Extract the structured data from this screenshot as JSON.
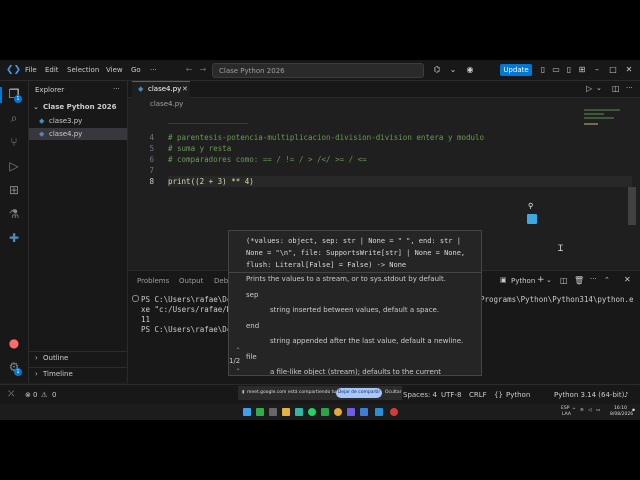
{
  "titlebar": {
    "menu": [
      "File",
      "Edit",
      "Selection",
      "View",
      "Go"
    ],
    "more": "···",
    "search_text": "Clase Python 2026",
    "update_label": "Update"
  },
  "sidebar": {
    "header": "Explorer",
    "folder": "Clase Python 2026",
    "files": [
      "clase3.py",
      "clase4.py"
    ],
    "outline": "Outline",
    "timeline": "Timeline"
  },
  "editor": {
    "tab_label": "clase4.py",
    "breadcrumb": "clase4.py",
    "lines": [
      {
        "num": "4",
        "text": "# parentesis-potencia-multiplicacion-division-division entera y modulo",
        "type": "comment"
      },
      {
        "num": "5",
        "text": "# suma y resta",
        "type": "comment"
      },
      {
        "num": "6",
        "text": "# comparadores como: == / != / > /</ >= / <=",
        "type": "comment"
      },
      {
        "num": "7",
        "text": "",
        "type": "blank"
      },
      {
        "num": "8",
        "text": "print((2 + 3) ** 4)",
        "type": "code"
      }
    ]
  },
  "hover": {
    "signature": "(*values: object, sep: str | None = \" \", end: str | None = \"\\n\", file: SupportsWrite[str] | None = None, flush: Literal[False] = False) -> None",
    "description": "Prints the values to a stream, or to sys.stdout by default.",
    "params": [
      {
        "name": "sep",
        "desc": "string inserted between values, default a space."
      },
      {
        "name": "end",
        "desc": "string appended after the last value, default a newline."
      },
      {
        "name": "file",
        "desc": "a file-like object (stream); defaults to the current"
      }
    ],
    "counter": "1/2"
  },
  "panel": {
    "tabs": [
      "Problems",
      "Output",
      "Deb"
    ],
    "python_label": "Python",
    "terminal": [
      "PS C:\\Users\\rafae\\Dc",
      "xe \"c:/Users/rafae/D",
      "11",
      "PS C:\\Users\\rafae\\Dc"
    ],
    "terminal_right": "Programs\\Python\\Python314\\python.e"
  },
  "statusbar": {
    "errors": "0",
    "warnings": "0",
    "spaces": "Spaces: 4",
    "encoding": "UTF-8",
    "eol": "CRLF",
    "language": "Python",
    "interpreter": "Python 3.14 (64-bit)"
  },
  "toast": {
    "message": "meet.google.com está compartiendo tu pantalla.",
    "button": "Dejar de compartir",
    "dismiss": "Ocultar"
  },
  "taskbar": {
    "lang": "ESP",
    "lang2": "LAA",
    "time": "16:10",
    "date": "8/08/2026"
  },
  "colors": {
    "accent": "#0078d4",
    "comment": "#6a9955",
    "background": "#1f1f1f"
  }
}
